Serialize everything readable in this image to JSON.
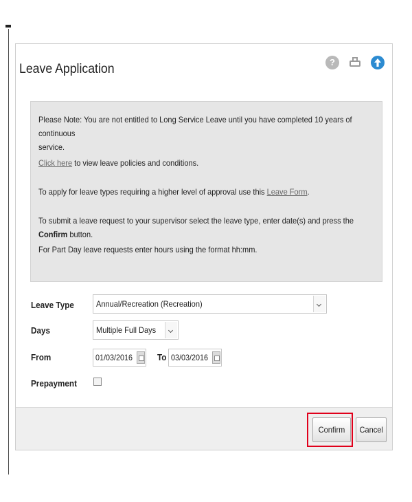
{
  "window": {
    "title": "Leave Application",
    "caption_fragment": "· · · · · · · · · · · · · · · · · · ·"
  },
  "header_icons": {
    "help": "help-icon",
    "print": "print-icon",
    "scroll_top": "arrow-up-icon",
    "accent_color": "#2c8bd1"
  },
  "note": {
    "line1": "Please Note: You are not entitled to Long Service Leave until you have completed 10 years of continuous",
    "line1b": "service.",
    "click_here": "Click here",
    "line2_rest": " to view leave policies and conditions.",
    "line3_pre": "To apply for leave types requiring a higher level of approval use this ",
    "leave_form": "Leave Form",
    "line3_post": ".",
    "line4_pre": "To submit a leave request to your supervisor select the leave type, enter date(s) and press the ",
    "line4_bold": "Confirm",
    "line4_post": " button.",
    "line5": "For Part Day leave requests enter hours using the format hh:mm."
  },
  "form": {
    "leave_type_label": "Leave Type",
    "leave_type_value": "Annual/Recreation (Recreation)",
    "days_label": "Days",
    "days_value": "Multiple Full Days",
    "from_label": "From",
    "from_value": "01/03/2016",
    "to_label": "To",
    "to_value": "03/03/2016",
    "prepayment_label": "Prepayment",
    "prepayment_checked": false
  },
  "footer": {
    "confirm_label": "Confirm",
    "cancel_label": "Cancel",
    "highlight_color": "#e0001b"
  }
}
